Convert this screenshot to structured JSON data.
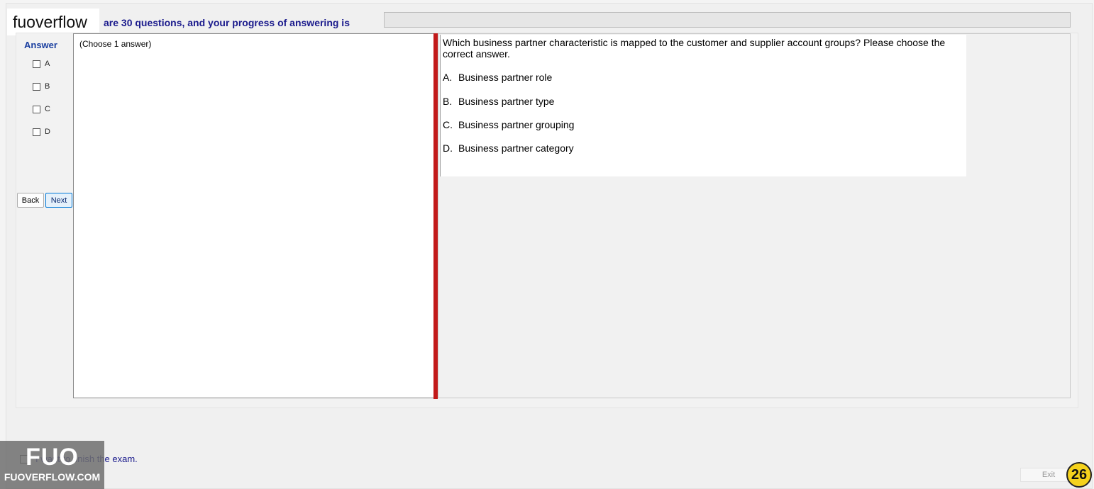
{
  "logo": {
    "text": "fuoverflow"
  },
  "header": {
    "progress_text": "are 30 questions, and your progress of answering is",
    "progress_fraction": 0
  },
  "answer_panel": {
    "title": "Answer",
    "options": [
      "A",
      "B",
      "C",
      "D"
    ],
    "back_label": "Back",
    "next_label": "Next"
  },
  "left_panel": {
    "choose_label": "(Choose 1 answer)"
  },
  "question": {
    "text": "Which business partner characteristic is mapped to the customer and supplier account groups? Please choose the correct answer.",
    "choices": [
      {
        "letter": "A.",
        "text": "Business partner role"
      },
      {
        "letter": "B.",
        "text": "Business partner type"
      },
      {
        "letter": "C.",
        "text": "Business partner grouping"
      },
      {
        "letter": "D.",
        "text": "Business partner category"
      }
    ]
  },
  "footer": {
    "finish_text": "I want to finish the exam.",
    "exit_label": "Exit",
    "page_number": "26",
    "watermark_big": "FUO",
    "watermark_small": "FUOVERFLOW.COM"
  },
  "colors": {
    "header_text": "#1a1a8c",
    "answer_title": "#1a3fa0",
    "divider": "#c21a1a",
    "badge": "#f5d21c"
  }
}
